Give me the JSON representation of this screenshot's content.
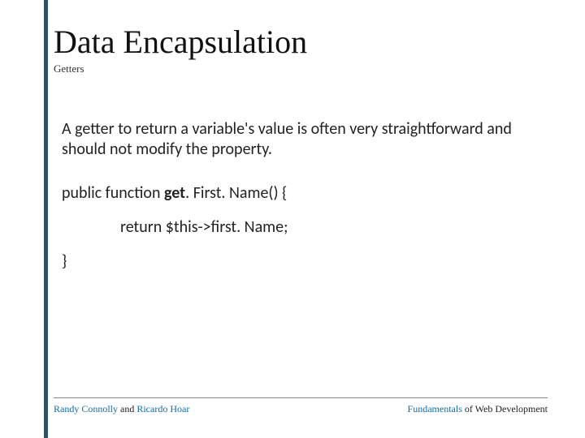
{
  "title": "Data Encapsulation",
  "subtitle": "Getters",
  "paragraph": "A getter to return a variable's value is often very straightforward and should not modify the property.",
  "code": {
    "l1_prefix": "public function ",
    "l1_bold": "get",
    "l1_suffix": ". First. Name() {",
    "l2": "return $this->first. Name;",
    "l3": "}"
  },
  "footer": {
    "left_link1": "Randy Connolly",
    "left_mid": " and ",
    "left_link2": "Ricardo Hoar",
    "right_link": "Fundamentals",
    "right_suffix": " of Web Development"
  }
}
